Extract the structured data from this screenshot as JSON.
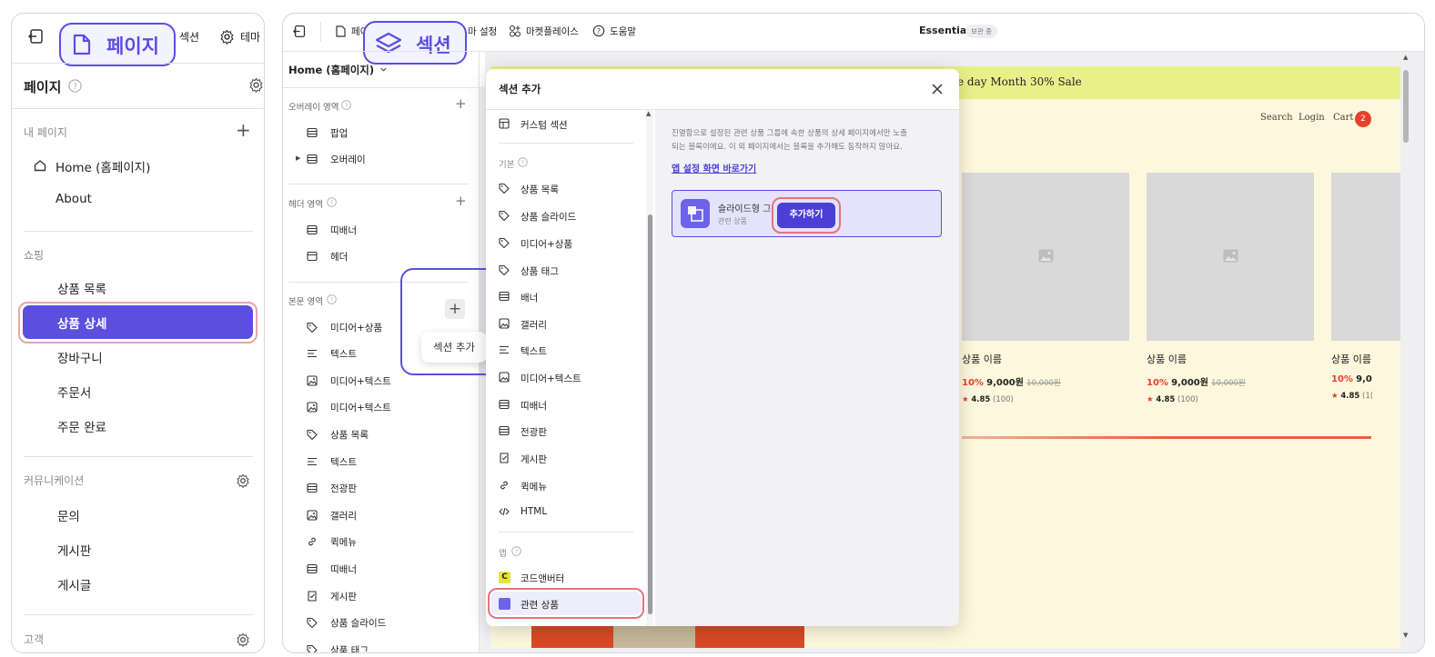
{
  "left_panel": {
    "tab_pages": "페이지",
    "tab_section_partial": "섹션",
    "tab_theme_partial": "테마",
    "title": "페이지",
    "my_pages": {
      "label": "내 페이지",
      "items": [
        "Home (홈페이지)",
        "About"
      ]
    },
    "shopping": {
      "label": "쇼핑",
      "items": [
        "상품 목록",
        "상품 상세",
        "장바구니",
        "주문서",
        "주문 완료"
      ]
    },
    "community": {
      "label": "커뮤니케이션",
      "items": [
        "문의",
        "게시판",
        "게시글"
      ]
    },
    "customer": {
      "label": "고객"
    }
  },
  "toolbar": {
    "page_partial": "페이",
    "section_label": "섹션",
    "theme_settings_partial": "마 설정",
    "marketplace": "마켓플레이스",
    "help": "도움말",
    "theme_name": "Essential",
    "theme_badge": "보관 중"
  },
  "section_panel": {
    "page_select": "Home (홈페이지)",
    "overlay_area": {
      "label": "오버레이 영역",
      "items": [
        "팝업",
        "오버레이"
      ]
    },
    "header_area": {
      "label": "헤더 영역",
      "items": [
        "띠배너",
        "헤더"
      ]
    },
    "body_area": {
      "label": "본문 영역",
      "items": [
        "미디어+상품",
        "텍스트",
        "미디어+텍스트",
        "미디어+텍스트",
        "상품 목록",
        "텍스트",
        "전광판",
        "갤러리",
        "퀵메뉴",
        "띠배너",
        "게시판",
        "상품 슬라이드",
        "상품 태그"
      ]
    },
    "add_section_tooltip": "섹션 추가"
  },
  "modal": {
    "title": "섹션 추가",
    "custom_section": "커스텀 섹션",
    "basic_label": "기본",
    "basic_items": [
      "상품 목록",
      "상품 슬라이드",
      "미디어+상품",
      "상품 태그",
      "배너",
      "갤러리",
      "텍스트",
      "미디어+텍스트",
      "띠배너",
      "전광판",
      "게시판",
      "퀵메뉴",
      "HTML"
    ],
    "apps_label": "앱",
    "app_items": [
      "코드앤버터",
      "관련 상품"
    ],
    "info_text_line1": "진열함으로 설정된 관련 상품 그룹에 속한 상품의 상세 페이지에서만 노출",
    "info_text_line2": "되는 블록이에요. 이 외 페이지에서는 블록을 추가해도 동작하지 않아요.",
    "app_settings_link": "앱 설정 화면 바로가기",
    "card_title": "슬라이드형 그룹",
    "card_subtitle": "관련 상품",
    "add_button": "추가하기"
  },
  "preview": {
    "banner_text": "e day Month 30% Sale",
    "nav_search": "Search",
    "nav_login": "Login",
    "nav_cart": "Cart",
    "cart_count": "2",
    "products": [
      {
        "name": "상품 이름",
        "discount": "10%",
        "price": "9,000원",
        "original": "10,000원",
        "rating": "4.85",
        "reviews": "(100)"
      },
      {
        "name": "상품 이름",
        "discount": "10%",
        "price": "9,000원",
        "original": "10,000원",
        "rating": "4.85",
        "reviews": "(100)"
      },
      {
        "name": "상품 이름",
        "discount": "10%",
        "price": "9,0",
        "original": "",
        "rating": "4.85",
        "reviews": "(1("
      }
    ]
  },
  "colors": {
    "accent": "#5b4fe0",
    "highlight_ring": "#e8727e",
    "banner": "#e9f08a",
    "preview_bg": "#fdf7dd",
    "discount": "#e8402c"
  }
}
